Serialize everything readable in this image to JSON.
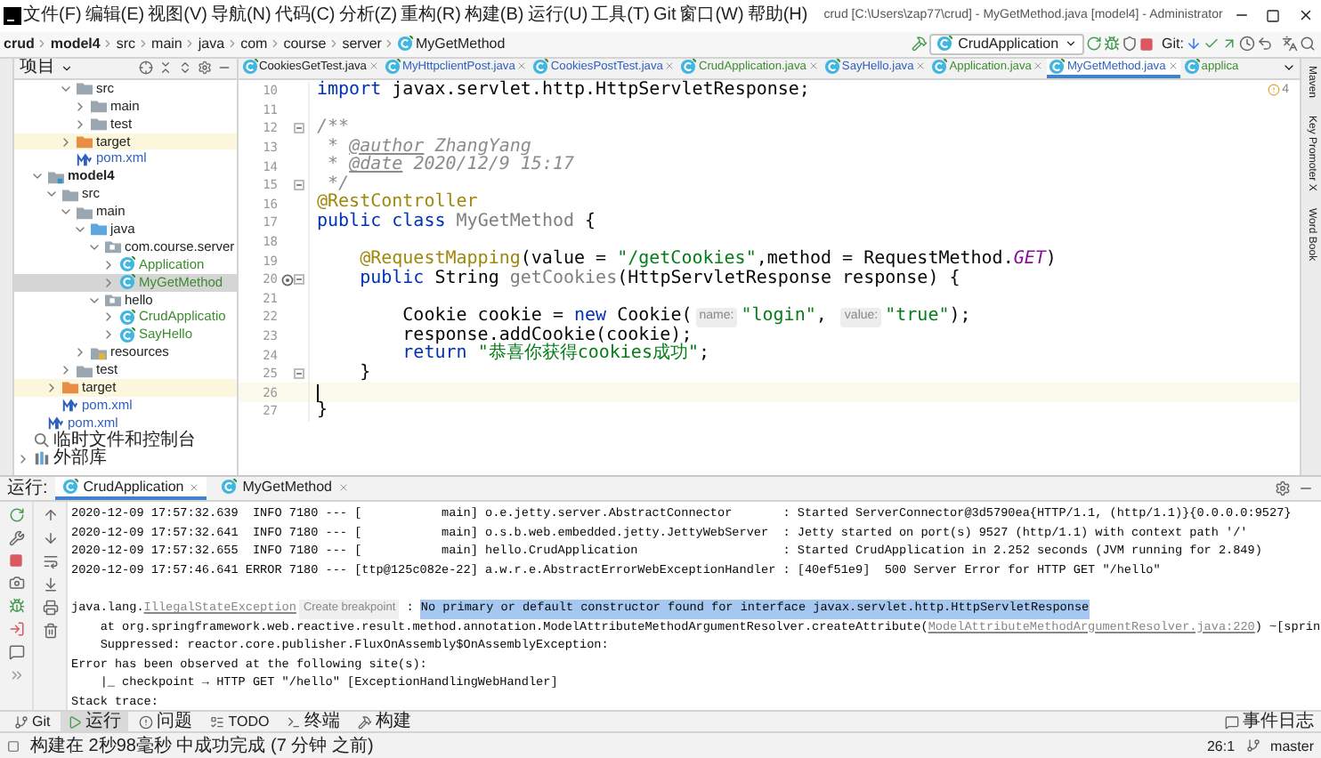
{
  "window": {
    "title": "crud [C:\\Users\\zap77\\crud] - MyGetMethod.java [model4] - Administrator"
  },
  "menu": [
    "文件(F)",
    "编辑(E)",
    "视图(V)",
    "导航(N)",
    "代码(C)",
    "分析(Z)",
    "重构(R)",
    "构建(B)",
    "运行(U)",
    "工具(T)",
    "Git",
    "窗口(W)",
    "帮助(H)"
  ],
  "breadcrumbs": [
    "crud",
    "model4",
    "src",
    "main",
    "java",
    "com",
    "course",
    "server",
    "MyGetMethod"
  ],
  "run_config": "CrudApplication",
  "git_label": "Git:",
  "project_panel": {
    "title": "项目"
  },
  "tree": {
    "continued": [
      {
        "label": "src",
        "kind": "folder",
        "expanded": true,
        "selected": false,
        "children": [
          {
            "label": "main",
            "kind": "folder",
            "expanded": false,
            "selected": false
          },
          {
            "label": "test",
            "kind": "folder",
            "expanded": false,
            "selected": false
          }
        ]
      },
      {
        "label": "target",
        "kind": "excluded",
        "expanded": false,
        "selected": false
      },
      {
        "label": "pom.xml",
        "kind": "maven",
        "color": "#2f5fbf",
        "selected": false
      }
    ],
    "modules": [
      {
        "label": "model4",
        "kind": "module",
        "bold": true,
        "expanded": true,
        "selected": false,
        "children": [
          {
            "label": "src",
            "kind": "folder",
            "expanded": true,
            "selected": false,
            "children": [
              {
                "label": "main",
                "kind": "folder",
                "expanded": true,
                "selected": false,
                "children": [
                  {
                    "label": "java",
                    "kind": "source",
                    "expanded": true,
                    "selected": false,
                    "children": [
                      {
                        "label": "com.course.server",
                        "kind": "package",
                        "expanded": true,
                        "selected": false,
                        "children": [
                          {
                            "label": "Application",
                            "kind": "class",
                            "color": "#3c8c2f",
                            "expanded": false,
                            "selected": false
                          },
                          {
                            "label": "MyGetMethod",
                            "kind": "class",
                            "color": "#3c8c2f",
                            "expanded": false,
                            "selected": true
                          }
                        ]
                      },
                      {
                        "label": "hello",
                        "kind": "package",
                        "expanded": true,
                        "selected": false,
                        "children": [
                          {
                            "label": "CrudApplicatio",
                            "kind": "class",
                            "color": "#3c8c2f",
                            "expanded": false,
                            "selected": false
                          },
                          {
                            "label": "SayHello",
                            "kind": "class",
                            "color": "#3c8c2f",
                            "expanded": false,
                            "selected": false
                          }
                        ]
                      }
                    ]
                  },
                  {
                    "label": "resources",
                    "kind": "resources",
                    "expanded": false,
                    "selected": false
                  }
                ]
              },
              {
                "label": "test",
                "kind": "folder",
                "expanded": false,
                "selected": false
              }
            ]
          },
          {
            "label": "target",
            "kind": "excluded",
            "expanded": false,
            "selected": false
          },
          {
            "label": "pom.xml",
            "kind": "maven",
            "color": "#2f5fbf",
            "selected": false
          }
        ]
      },
      {
        "label": "pom.xml",
        "kind": "maven",
        "color": "#2f5fbf",
        "selected": false
      }
    ],
    "items": [
      {
        "label": "临时文件和控制台",
        "kind": "scratch",
        "selected": false
      },
      {
        "label": "外部库",
        "kind": "library",
        "expanded": false,
        "selected": false
      }
    ]
  },
  "tabs": [
    {
      "label": "CookiesGetTest.java",
      "color": "#222222",
      "selected": false
    },
    {
      "label": "MyHttpclientPost.java",
      "color": "#2f5fbf",
      "selected": false
    },
    {
      "label": "CookiesPostTest.java",
      "color": "#2f5fbf",
      "selected": false
    },
    {
      "label": "CrudApplication.java",
      "color": "#3c8c2f",
      "selected": false
    },
    {
      "label": "SayHello.java",
      "color": "#2f5fbf",
      "selected": false
    },
    {
      "label": "Application.java",
      "color": "#3c8c2f",
      "selected": false
    },
    {
      "label": "MyGetMethod.java",
      "color": "#2f5fbf",
      "selected": true
    },
    {
      "label": "applica",
      "color": "#3c8c2f",
      "selected": false
    }
  ],
  "inspection_count": "4",
  "code": [
    {
      "number": "10",
      "current": false,
      "tokens": [
        {
          "kind": "kw",
          "text": "import "
        },
        {
          "kind": "plain",
          "text": "javax.servlet.http.HttpServletResponse;"
        }
      ]
    },
    {
      "number": "11",
      "current": false
    },
    {
      "number": "12",
      "current": false,
      "fold": true,
      "tokens": [
        {
          "kind": "cmt",
          "text": "/**"
        }
      ]
    },
    {
      "number": "13",
      "current": false,
      "tokens": [
        {
          "kind": "cmt",
          "text": " * "
        },
        {
          "kind": "tag",
          "text": "@author"
        },
        {
          "kind": "cmt",
          "text": " ZhangYang"
        }
      ]
    },
    {
      "number": "14",
      "current": false,
      "tokens": [
        {
          "kind": "cmt",
          "text": " * "
        },
        {
          "kind": "tag",
          "text": "@date"
        },
        {
          "kind": "cmt",
          "text": " 2020/12/9 15:17"
        }
      ]
    },
    {
      "number": "15",
      "current": false,
      "fold": true,
      "tokens": [
        {
          "kind": "cmt",
          "text": " */"
        }
      ]
    },
    {
      "number": "16",
      "current": false,
      "tokens": [
        {
          "kind": "ann",
          "text": "@RestController"
        }
      ]
    },
    {
      "number": "17",
      "current": false,
      "tokens": [
        {
          "kind": "kw",
          "text": "public class "
        },
        {
          "kind": "unused",
          "text": "MyGetMethod"
        },
        {
          "kind": "plain",
          "text": " {"
        }
      ]
    },
    {
      "number": "18",
      "current": false
    },
    {
      "number": "19",
      "current": false,
      "tokens": [
        {
          "kind": "ann",
          "text": "    @RequestMapping"
        },
        {
          "kind": "plain",
          "text": "(value = "
        },
        {
          "kind": "str",
          "text": "\"/getCookies\""
        },
        {
          "kind": "plain",
          "text": ",method = RequestMethod."
        },
        {
          "kind": "const",
          "text": "GET"
        },
        {
          "kind": "plain",
          "text": ")"
        }
      ]
    },
    {
      "number": "20",
      "current": false,
      "fold": true,
      "endpoint_marker": true,
      "tokens": [
        {
          "kind": "kw",
          "text": "    public "
        },
        {
          "kind": "plain",
          "text": "String "
        },
        {
          "kind": "unused",
          "text": "getCookies"
        },
        {
          "kind": "plain",
          "text": "(HttpServletResponse response) {"
        }
      ]
    },
    {
      "number": "21",
      "current": false
    },
    {
      "number": "22",
      "current": false,
      "tokens": [
        {
          "kind": "plain",
          "text": "        Cookie cookie = "
        },
        {
          "kind": "kw",
          "text": "new "
        },
        {
          "kind": "plain",
          "text": "Cookie("
        },
        {
          "kind": "hint",
          "text": "name:"
        },
        {
          "kind": "str",
          "text": "\"login\""
        },
        {
          "kind": "plain",
          "text": ", "
        },
        {
          "kind": "hint",
          "text": "value:"
        },
        {
          "kind": "str",
          "text": "\"true\""
        },
        {
          "kind": "plain",
          "text": ");"
        }
      ]
    },
    {
      "number": "23",
      "current": false,
      "tokens": [
        {
          "kind": "plain",
          "text": "        response.addCookie(cookie);"
        }
      ]
    },
    {
      "number": "24",
      "current": false,
      "tokens": [
        {
          "kind": "kw",
          "text": "        return "
        },
        {
          "kind": "str",
          "text": "\"恭喜你获得cookies成功\""
        },
        {
          "kind": "plain",
          "text": ";"
        }
      ]
    },
    {
      "number": "25",
      "current": false,
      "fold": true,
      "tokens": [
        {
          "kind": "plain",
          "text": "    }"
        }
      ]
    },
    {
      "number": "26",
      "current": true
    },
    {
      "number": "27",
      "current": false,
      "tokens": [
        {
          "kind": "plain",
          "text": "}"
        }
      ]
    }
  ],
  "run_panel": {
    "label": "运行:",
    "tabs": [
      {
        "label": "CrudApplication",
        "selected": true
      },
      {
        "label": "MyGetMethod",
        "selected": false
      }
    ]
  },
  "console": [
    {
      "kind": "line",
      "tokens": [
        {
          "kind": "plain",
          "text": "2020-12-09 17:57:32.639  INFO 7180 --- [           main] o.e.jetty.server.AbstractConnector       : Started ServerConnector@3d5790ea{HTTP/1.1, (http/1.1)}{0.0.0.0:9527}"
        }
      ]
    },
    {
      "kind": "line",
      "tokens": [
        {
          "kind": "plain",
          "text": "2020-12-09 17:57:32.641  INFO 7180 --- [           main] o.s.b.web.embedded.jetty.JettyWebServer  : Jetty started on port(s) 9527 (http/1.1) with context path '/'"
        }
      ]
    },
    {
      "kind": "line",
      "tokens": [
        {
          "kind": "plain",
          "text": "2020-12-09 17:57:32.655  INFO 7180 --- [           main] hello.CrudApplication                    : Started CrudApplication in 2.252 seconds (JVM running for 2.849)"
        }
      ]
    },
    {
      "kind": "line",
      "tokens": [
        {
          "kind": "plain",
          "text": "2020-12-09 17:57:46.641 ERROR 7180 --- [ttp@125c082e-22] a.w.r.e.AbstractErrorWebExceptionHandler : [40ef51e9]  500 Server Error for HTTP GET \"/hello\""
        }
      ]
    },
    {
      "kind": "blank"
    },
    {
      "kind": "line",
      "tokens": [
        {
          "kind": "plain",
          "text": "java.lang."
        },
        {
          "kind": "link",
          "text": "IllegalStateException"
        },
        {
          "kind": "hint",
          "text": "Create breakpoint"
        },
        {
          "kind": "plain",
          "text": " : "
        },
        {
          "kind": "highlight",
          "text": "No primary or default constructor found for interface javax.servlet.http.HttpServletResponse"
        }
      ]
    },
    {
      "kind": "line",
      "tokens": [
        {
          "kind": "plain",
          "text": "    at org.springframework.web.reactive.result.method.annotation.ModelAttributeMethodArgumentResolver.createAttribute("
        },
        {
          "kind": "link",
          "text": "ModelAttributeMethodArgumentResolver.java:220"
        },
        {
          "kind": "plain",
          "text": ") ~[sprin"
        }
      ]
    },
    {
      "kind": "line",
      "tokens": [
        {
          "kind": "plain",
          "text": "    Suppressed: reactor.core.publisher.FluxOnAssembly$OnAssemblyException:"
        }
      ]
    },
    {
      "kind": "line",
      "tokens": [
        {
          "kind": "plain",
          "text": "Error has been observed at the following site(s):"
        }
      ]
    },
    {
      "kind": "line",
      "tokens": [
        {
          "kind": "plain",
          "text": "    |_ checkpoint → HTTP GET \"/hello\" [ExceptionHandlingWebHandler]"
        }
      ]
    },
    {
      "kind": "line",
      "tokens": [
        {
          "kind": "plain",
          "text": "Stack trace:"
        }
      ]
    }
  ],
  "right_strip": [
    "Maven",
    "Key Promoter X",
    "Word Book"
  ],
  "tool_buttons": [
    {
      "label": "Git",
      "kind": "git",
      "selected": false
    },
    {
      "label": "运行",
      "kind": "run",
      "selected": true
    },
    {
      "label": "问题",
      "kind": "problems",
      "selected": false
    },
    {
      "label": "TODO",
      "kind": "todo",
      "selected": false
    },
    {
      "label": "终端",
      "kind": "terminal",
      "selected": false
    },
    {
      "label": "构建",
      "kind": "build",
      "selected": false
    }
  ],
  "event_log": "事件日志",
  "status_bar": {
    "message": "构建在 2秒98毫秒 中成功完成 (7 分钟 之前)",
    "position": "26:1",
    "branch": "master"
  }
}
